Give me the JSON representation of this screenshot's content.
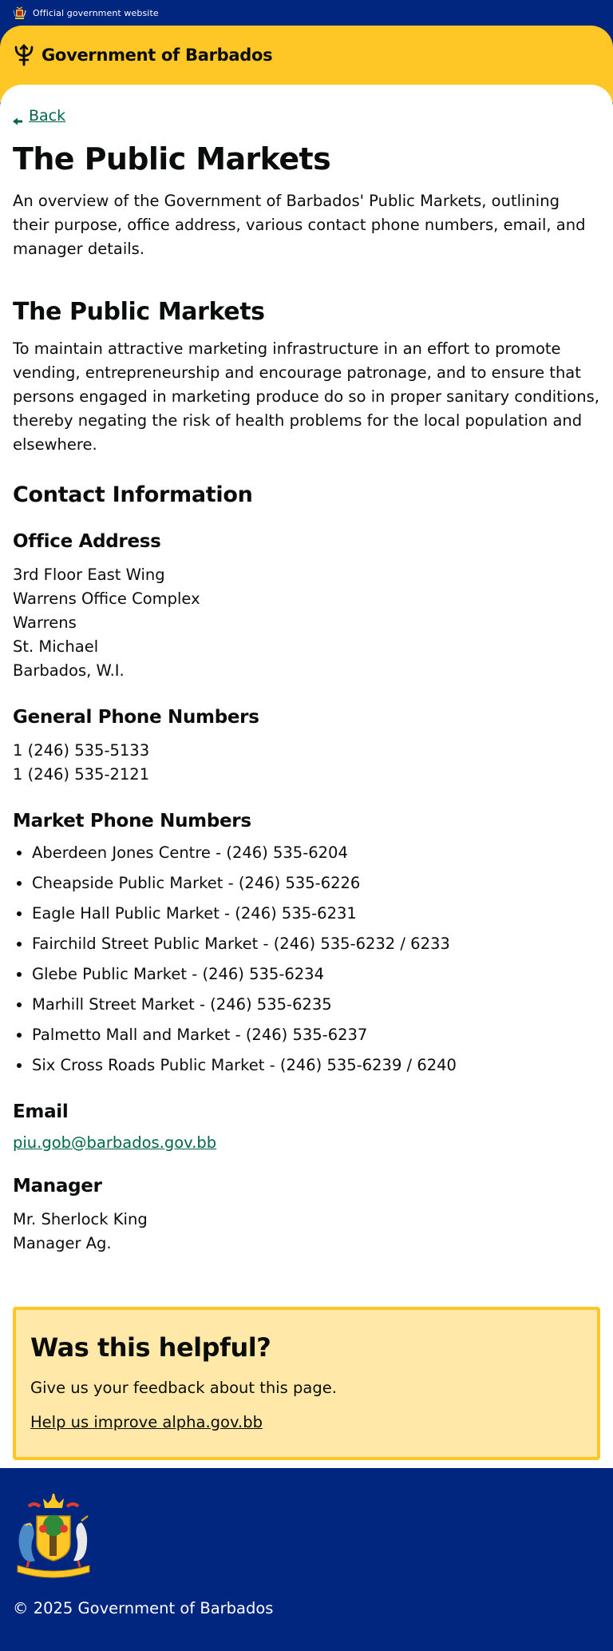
{
  "topbar": {
    "official_text": "Official government website"
  },
  "header": {
    "title": "Government of Barbados"
  },
  "main": {
    "back_label": "Back",
    "title": "The Public Markets",
    "lede": "An overview of the Government of Barbados' Public Markets, outlining their purpose, office address, various contact phone numbers, email, and manager details.",
    "section_title": "The Public Markets",
    "purpose": "To maintain attractive marketing infrastructure in an effort to promote vending, entrepreneurship and encourage patronage, and to ensure that persons engaged in marketing produce do so in proper sanitary conditions, thereby negating the risk of health problems for the local population and elsewhere.",
    "contact_heading": "Contact Information",
    "office": {
      "heading": "Office Address",
      "lines": [
        "3rd Floor East Wing",
        "Warrens Office Complex",
        "Warrens",
        "St. Michael",
        "Barbados, W.I."
      ]
    },
    "general_phones": {
      "heading": "General Phone Numbers",
      "lines": [
        "1 (246) 535-5133",
        "1 (246) 535-2121"
      ]
    },
    "market_phones": {
      "heading": "Market Phone Numbers",
      "items": [
        "Aberdeen Jones Centre - (246) 535-6204",
        "Cheapside Public Market - (246) 535-6226",
        "Eagle Hall Public Market - (246) 535-6231",
        "Fairchild Street Public Market - (246) 535-6232 / 6233",
        "Glebe Public Market - (246) 535-6234",
        "Marhill Street Market - (246) 535-6235",
        "Palmetto Mall and Market - (246) 535-6237",
        "Six Cross Roads Public Market - (246) 535-6239 / 6240"
      ]
    },
    "email": {
      "heading": "Email",
      "address": "piu.gob@barbados.gov.bb"
    },
    "manager": {
      "heading": "Manager",
      "lines": [
        "Mr. Sherlock King",
        "Manager Ag."
      ]
    }
  },
  "feedback": {
    "title": "Was this helpful?",
    "text": "Give us your feedback about this page.",
    "link": "Help us improve alpha.gov.bb"
  },
  "footer": {
    "copyright": "© 2025 Government of Barbados"
  },
  "colors": {
    "navy": "#00267f",
    "yellow": "#ffc726",
    "link_green": "#00654a",
    "feedback_bg": "#ffe8a8"
  },
  "icons": {
    "topbar": "coat-of-arms-icon",
    "header": "trident-icon",
    "back": "arrow-left-icon",
    "footer": "coat-of-arms-icon"
  }
}
